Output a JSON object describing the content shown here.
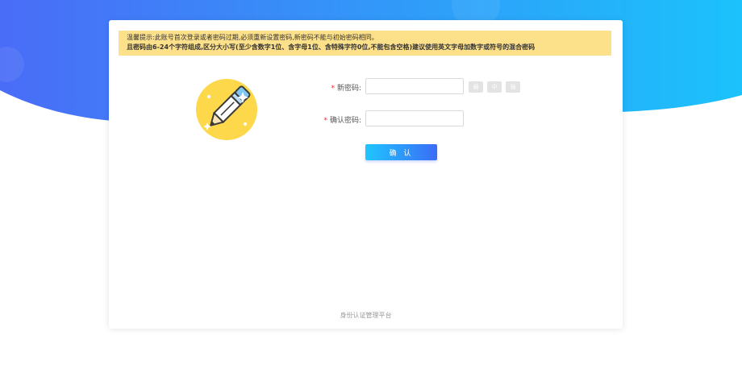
{
  "notice": {
    "line1": "温馨提示:此账号首次登录或者密码过期,必须重新设置密码,新密码不能与初始密码相同。",
    "line2": "且密码由6-24个字符组成,区分大小写(至少含数字1位、含字母1位、含特殊字符0位,不能包含空格)建议使用英文字母加数字或符号的混合密码"
  },
  "form": {
    "required_mark": "*",
    "new_password_label": "新密码:",
    "new_password_value": "",
    "confirm_password_label": "确认密码:",
    "confirm_password_value": "",
    "strength_levels": [
      "弱",
      "中",
      "强"
    ],
    "confirm_button": "确 认"
  },
  "footer": {
    "text": "身份认证管理平台"
  },
  "colors": {
    "bg_gradient_left": "#4a6cf7",
    "bg_gradient_right": "#1bc2fb",
    "notice_bg": "#fde08a",
    "button_left": "#1fc6ff",
    "button_right": "#3b6cf6",
    "required": "#f5222d"
  },
  "icons": {
    "illustration": "pencil-icon"
  }
}
